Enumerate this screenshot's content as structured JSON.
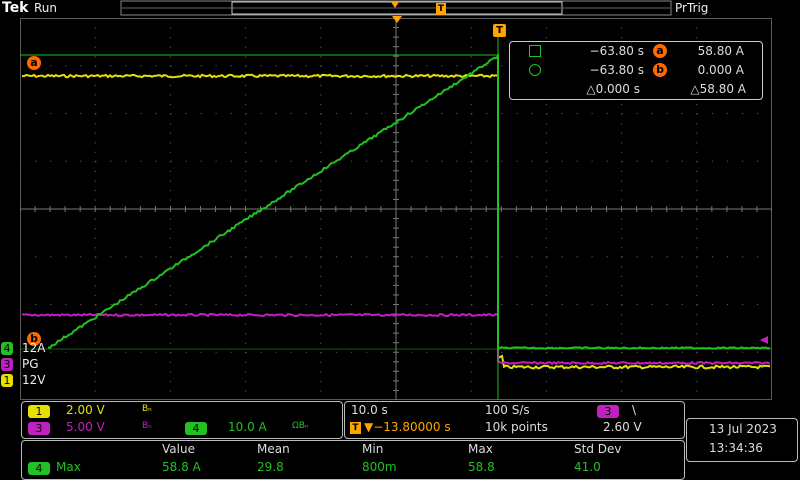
{
  "header": {
    "brand": "Tek",
    "state": "Run",
    "trigger_mode": "PrTrig",
    "trigger_marker": "T"
  },
  "cursor_readout": {
    "row1_time": "−63.80 s",
    "row1_label": "a",
    "row1_value": "58.80 A",
    "row2_time": "−63.80 s",
    "row2_label": "b",
    "row2_value": "0.000 A",
    "delta_time": "△0.000 s",
    "delta_value": "△58.80 A"
  },
  "markers": {
    "cursor_a": "a",
    "cursor_b": "b"
  },
  "channels_side": [
    {
      "num": "4",
      "label": "12A",
      "color": "#22c022"
    },
    {
      "num": "3",
      "label": "PG",
      "color": "#c020c0"
    },
    {
      "num": "1",
      "label": "12V",
      "color": "#e6e000"
    }
  ],
  "channel_settings": {
    "ch1": {
      "num": "1",
      "scale": "2.00 V",
      "bw": "Bₙ"
    },
    "ch3": {
      "num": "3",
      "scale": "5.00 V",
      "bw": "Bₙ"
    },
    "ch4": {
      "num": "4",
      "scale": "10.0 A",
      "bw": "ΩBₙ"
    }
  },
  "timebase": {
    "scale": "10.0 s",
    "sample_rate": "100 S/s",
    "trigger_pos": "▼−13.80000 s",
    "record": "10k points",
    "trigger_channel": "3",
    "slope": "\\",
    "level": "2.60 V"
  },
  "datetime": {
    "date": "13 Jul 2023",
    "time": "13:34:36"
  },
  "measurements": {
    "headers": [
      "Value",
      "Mean",
      "Min",
      "Max",
      "Std Dev"
    ],
    "row": {
      "channel": "4",
      "name": "Max",
      "values": [
        "58.8 A",
        "29.8",
        "800m",
        "58.8",
        "41.0"
      ]
    }
  },
  "colors": {
    "ch1": "#e6e000",
    "ch3": "#c020c0",
    "ch4": "#22c022",
    "cursor": "#ff6a00",
    "grid": "#5a5a5a",
    "trigger": "#ffa500"
  }
}
